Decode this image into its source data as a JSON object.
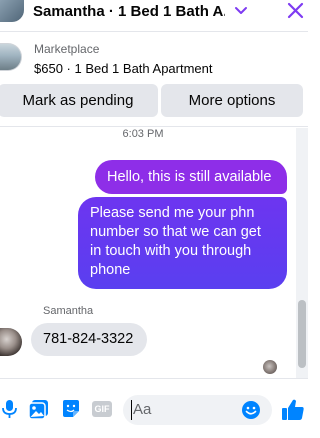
{
  "header": {
    "title": "Samantha · 1 Bed 1 Bath A...",
    "icons": [
      "chevron-down-icon",
      "close-icon"
    ],
    "accent": "#7e3bf2"
  },
  "marketplace": {
    "label": "Marketplace",
    "listing": "$650 · 1 Bed 1 Bath Apartment"
  },
  "actions": {
    "pending_label": "Mark as pending",
    "more_label": "More options"
  },
  "conversation": {
    "timestamp": "6:03 PM",
    "messages": [
      {
        "from": "me",
        "text": "Hello, this is still available"
      },
      {
        "from": "me",
        "text": "Please send me your phn number so that we can get in touch with you through phone"
      },
      {
        "from": "Samantha",
        "text": "781-824-3322"
      }
    ],
    "sender_name": "Samantha"
  },
  "composer": {
    "placeholder": "Aa",
    "icons": [
      "microphone-icon",
      "image-icon",
      "sticker-icon",
      "gif-icon",
      "emoji-icon",
      "thumbs-up-icon"
    ],
    "gif_label": "GIF"
  },
  "colors": {
    "outgoing_top": "#8e2ee8",
    "outgoing_bottom": "#5a3ff0",
    "incoming": "#e4e6eb",
    "icon_blue": "#0084ff"
  }
}
